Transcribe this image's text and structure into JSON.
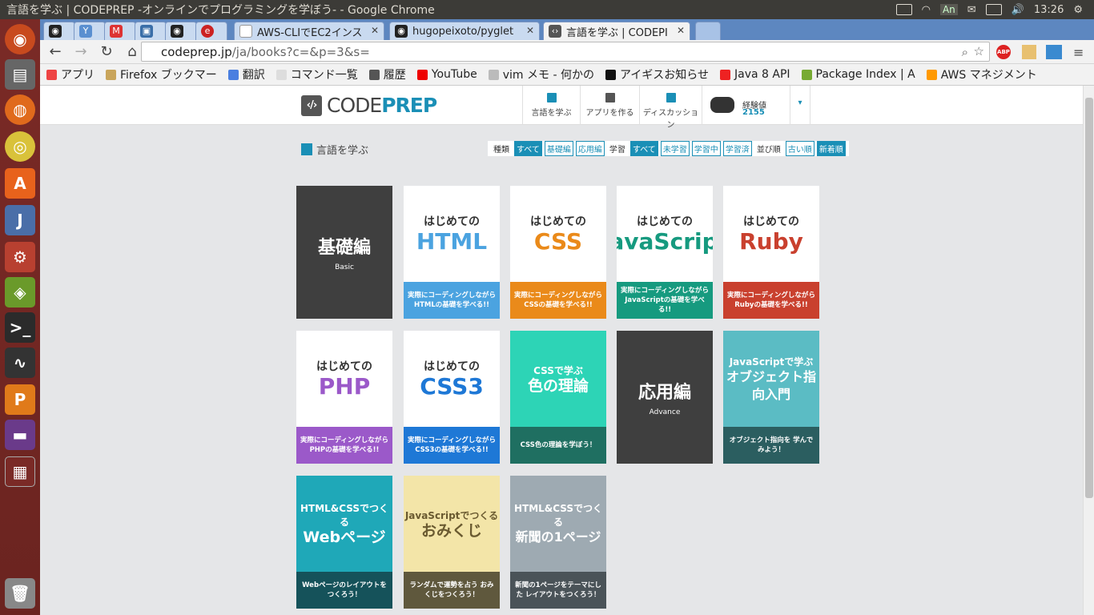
{
  "window": {
    "title": "言語を学ぶ | CODEPREP -オンラインでプログラミングを学ぼう- - Google Chrome",
    "time": "13:26",
    "ime": "An"
  },
  "tabs": [
    {
      "label": ""
    },
    {
      "label": ""
    },
    {
      "label": ""
    },
    {
      "label": ""
    },
    {
      "label": ""
    },
    {
      "label": ""
    },
    {
      "label": "AWS-CLIでEC2インス"
    },
    {
      "label": "hugopeixoto/pyglet"
    },
    {
      "label": "言語を学ぶ | CODEPI"
    }
  ],
  "url": {
    "host": "codeprep.jp",
    "path": "/ja/books?c=&p=3&s="
  },
  "bookmarks": [
    {
      "label": "アプリ",
      "color": "#e44"
    },
    {
      "label": "Firefox ブックマー",
      "color": "#c9a55b"
    },
    {
      "label": "翻訳",
      "color": "#4a7fe0"
    },
    {
      "label": "コマンド一覧",
      "color": "#ddd"
    },
    {
      "label": "履歴",
      "color": "#555"
    },
    {
      "label": "YouTube",
      "color": "#e00"
    },
    {
      "label": "vim メモ - 何かの",
      "color": "#bbb"
    },
    {
      "label": "アイギスお知らせ",
      "color": "#111"
    },
    {
      "label": "Java 8 API",
      "color": "#e22"
    },
    {
      "label": "Package Index | A",
      "color": "#7a3"
    },
    {
      "label": "AWS マネジメント",
      "color": "#f90"
    }
  ],
  "site": {
    "logo_code": "CODE",
    "logo_prep": "PREP",
    "nav": [
      {
        "label": "言語を学ぶ"
      },
      {
        "label": "アプリを作る"
      },
      {
        "label": "ディスカッション"
      }
    ],
    "exp_label": "経験値",
    "exp_value": "2155",
    "dropdown": "▾"
  },
  "breadcrumb": "言語を学ぶ",
  "filters": {
    "kind_label": "種類",
    "kind": [
      {
        "label": "すべて",
        "on": true
      },
      {
        "label": "基礎編",
        "on": false
      },
      {
        "label": "応用編",
        "on": false
      }
    ],
    "study_label": "学習",
    "study": [
      {
        "label": "すべて",
        "on": true
      },
      {
        "label": "未学習",
        "on": false
      },
      {
        "label": "学習中",
        "on": false
      },
      {
        "label": "学習済",
        "on": false
      }
    ],
    "order_label": "並び順",
    "order": [
      {
        "label": "古い順",
        "on": false
      },
      {
        "label": "新着順",
        "on": true
      }
    ]
  },
  "cards": [
    {
      "type": "dark",
      "title": "基礎編",
      "sub": "Basic"
    },
    {
      "type": "book",
      "sub": "はじめての",
      "title": "HTML",
      "color": "#4ba3e0",
      "desc": "実際にコーディングしながら HTMLの基礎を学べる!!"
    },
    {
      "type": "book",
      "sub": "はじめての",
      "title": "CSS",
      "color": "#ea8a1a",
      "desc": "実際にコーディングしながら CSSの基礎を学べる!!"
    },
    {
      "type": "book",
      "sub": "はじめての",
      "title": "JavaScript",
      "color": "#169a7f",
      "desc": "実際にコーディングしながら JavaScriptの基礎を学べる!!"
    },
    {
      "type": "book",
      "sub": "はじめての",
      "title": "Ruby",
      "color": "#c9402e",
      "desc": "実際にコーディングしながら Rubyの基礎を学べる!!"
    },
    {
      "type": "book",
      "sub": "はじめての",
      "title": "PHP",
      "color": "#9b59c9",
      "desc": "実際にコーディングしながら PHPの基礎を学べる!!"
    },
    {
      "type": "book",
      "sub": "はじめての",
      "title": "CSS3",
      "color": "#1e78d6",
      "desc": "実際にコーディングしながら CSS3の基礎を学べる!!"
    },
    {
      "type": "color",
      "sub": "CSSで学ぶ",
      "title": "色の理論",
      "top": "#2dd4b6",
      "bot": "#1f6f61",
      "desc": "CSS色の理論を学ぼう！"
    },
    {
      "type": "dark",
      "title": "応用編",
      "sub": "Advance"
    },
    {
      "type": "color",
      "sub": "JavaScriptで学ぶ",
      "title": "オブジェクト指向入門",
      "top": "#5bbcc4",
      "bot": "#2b5e60",
      "desc": "オブジェクト指向を 学んでみよう！"
    },
    {
      "type": "color",
      "sub": "HTML&CSSでつくる",
      "title": "Webページ",
      "top": "#1fa8b8",
      "bot": "#15525a",
      "desc": "Webページのレイアウトを つくろう！"
    },
    {
      "type": "color",
      "sub": "JavaScriptでつくる",
      "title": "おみくじ",
      "top": "#f3e5a8",
      "bot": "#5f583d",
      "desc": "ランダムで運勢を占う おみくじをつくろう！",
      "dark": true
    },
    {
      "type": "color",
      "sub": "HTML&CSSでつくる",
      "title": "新聞の1ページ",
      "top": "#9eaab2",
      "bot": "#4a5358",
      "desc": "新聞の1ページをテーマにした レイアウトをつくろう！"
    }
  ]
}
